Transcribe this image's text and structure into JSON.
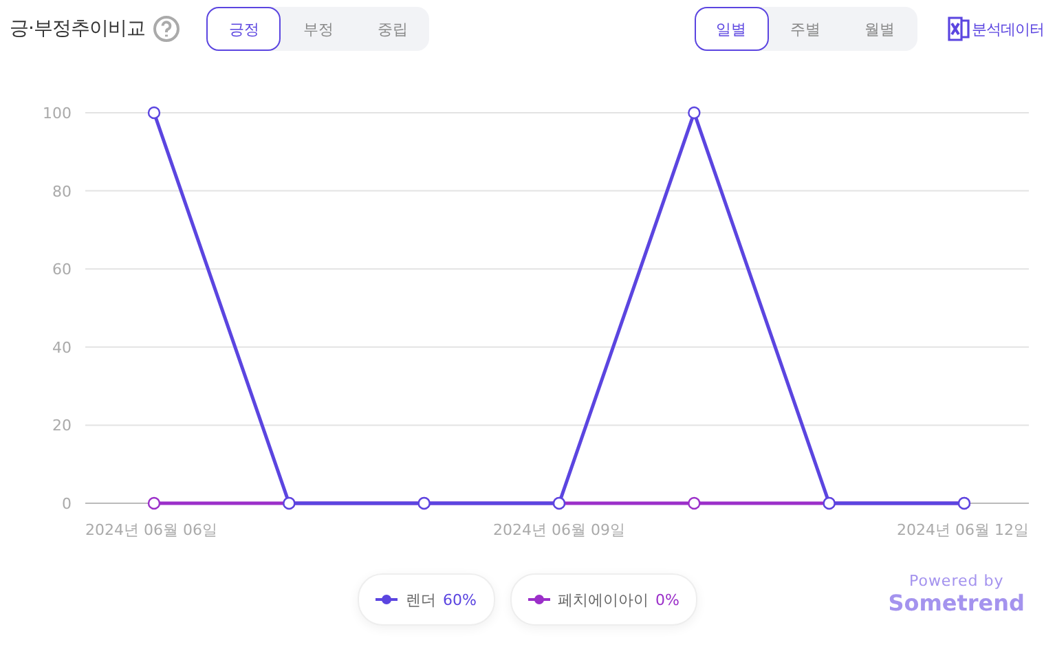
{
  "title": "긍·부정추이비교",
  "sentiment_tabs": [
    {
      "label": "긍정",
      "selected": true
    },
    {
      "label": "부정",
      "selected": false
    },
    {
      "label": "중립",
      "selected": false
    }
  ],
  "period_tabs": [
    {
      "label": "일별",
      "selected": true
    },
    {
      "label": "주별",
      "selected": false
    },
    {
      "label": "월별",
      "selected": false
    }
  ],
  "export_link": "분석데이터",
  "chart": {
    "chart_data": {
      "type": "line",
      "categories": [
        "2024년 06월 06일",
        null,
        null,
        "2024년 06월 09일",
        null,
        null,
        "2024년 06월 12일"
      ],
      "ylim": [
        0,
        100
      ],
      "grid": true,
      "yticks": [
        0,
        20,
        40,
        60,
        80,
        100
      ],
      "series": [
        {
          "name": "렌더",
          "color": "#5b45e0",
          "marker": "circle",
          "values": [
            100,
            0,
            0,
            0,
            100,
            0,
            0
          ]
        },
        {
          "name": "페치에이아이",
          "color": "#9b2fc9",
          "marker": "circle",
          "values": [
            0,
            0,
            0,
            0,
            0,
            0,
            0
          ]
        }
      ]
    }
  },
  "legend": [
    {
      "share": "60%"
    },
    {
      "share": "0%"
    }
  ],
  "powered_by": "Powered by",
  "brand": "Sometrend"
}
